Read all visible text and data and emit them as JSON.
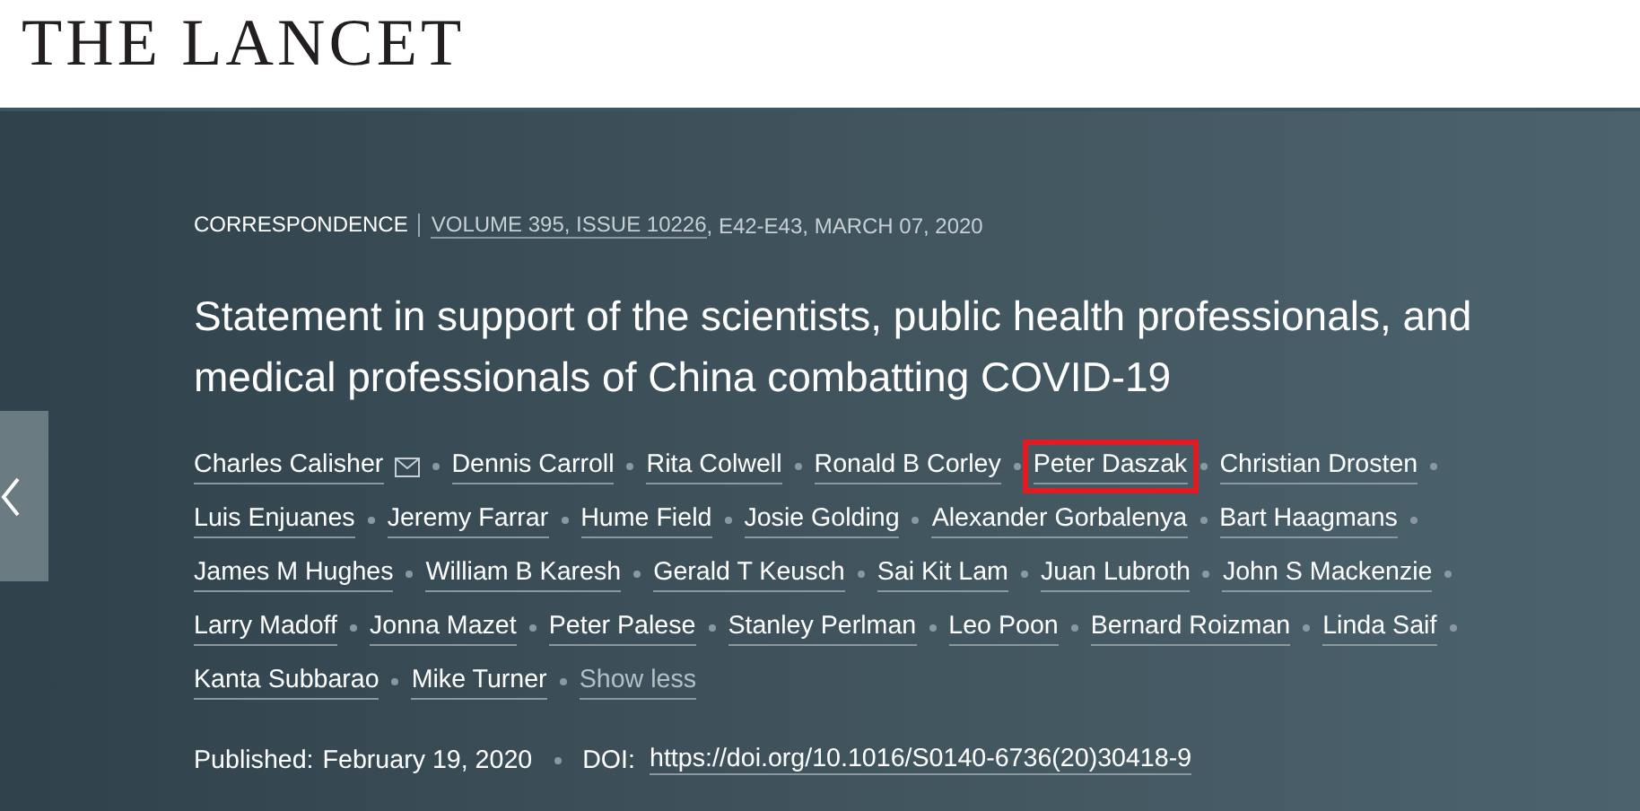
{
  "header": {
    "logo": "THE LANCET"
  },
  "article": {
    "type": "CORRESPONDENCE",
    "volume_link": "VOLUME 395, ISSUE 10226",
    "pages_date": ", E42-E43, MARCH 07, 2020",
    "title": "Statement in support of the scientists, public health professionals, and medical professionals of China combatting COVID-19",
    "authors": [
      {
        "name": "Charles Calisher",
        "email": true,
        "highlighted": false
      },
      {
        "name": "Dennis Carroll",
        "email": false,
        "highlighted": false
      },
      {
        "name": "Rita Colwell",
        "email": false,
        "highlighted": false
      },
      {
        "name": "Ronald B Corley",
        "email": false,
        "highlighted": false
      },
      {
        "name": "Peter Daszak",
        "email": false,
        "highlighted": true
      },
      {
        "name": "Christian Drosten",
        "email": false,
        "highlighted": false
      },
      {
        "name": "Luis Enjuanes",
        "email": false,
        "highlighted": false
      },
      {
        "name": "Jeremy Farrar",
        "email": false,
        "highlighted": false
      },
      {
        "name": "Hume Field",
        "email": false,
        "highlighted": false
      },
      {
        "name": "Josie Golding",
        "email": false,
        "highlighted": false
      },
      {
        "name": "Alexander Gorbalenya",
        "email": false,
        "highlighted": false
      },
      {
        "name": "Bart Haagmans",
        "email": false,
        "highlighted": false
      },
      {
        "name": "James M Hughes",
        "email": false,
        "highlighted": false
      },
      {
        "name": "William B Karesh",
        "email": false,
        "highlighted": false
      },
      {
        "name": "Gerald T Keusch",
        "email": false,
        "highlighted": false
      },
      {
        "name": "Sai Kit Lam",
        "email": false,
        "highlighted": false
      },
      {
        "name": "Juan Lubroth",
        "email": false,
        "highlighted": false
      },
      {
        "name": "John S Mackenzie",
        "email": false,
        "highlighted": false
      },
      {
        "name": "Larry Madoff",
        "email": false,
        "highlighted": false
      },
      {
        "name": "Jonna Mazet",
        "email": false,
        "highlighted": false
      },
      {
        "name": "Peter Palese",
        "email": false,
        "highlighted": false
      },
      {
        "name": "Stanley Perlman",
        "email": false,
        "highlighted": false
      },
      {
        "name": "Leo Poon",
        "email": false,
        "highlighted": false
      },
      {
        "name": "Bernard Roizman",
        "email": false,
        "highlighted": false
      },
      {
        "name": "Linda Saif",
        "email": false,
        "highlighted": false
      },
      {
        "name": "Kanta Subbarao",
        "email": false,
        "highlighted": false
      },
      {
        "name": "Mike Turner",
        "email": false,
        "highlighted": false
      }
    ],
    "show_less": "Show less",
    "published_label": "Published:",
    "published_date": "February 19, 2020",
    "doi_label": "DOI:",
    "doi": "https://doi.org/10.1016/S0140-6736(20)30418-9"
  }
}
